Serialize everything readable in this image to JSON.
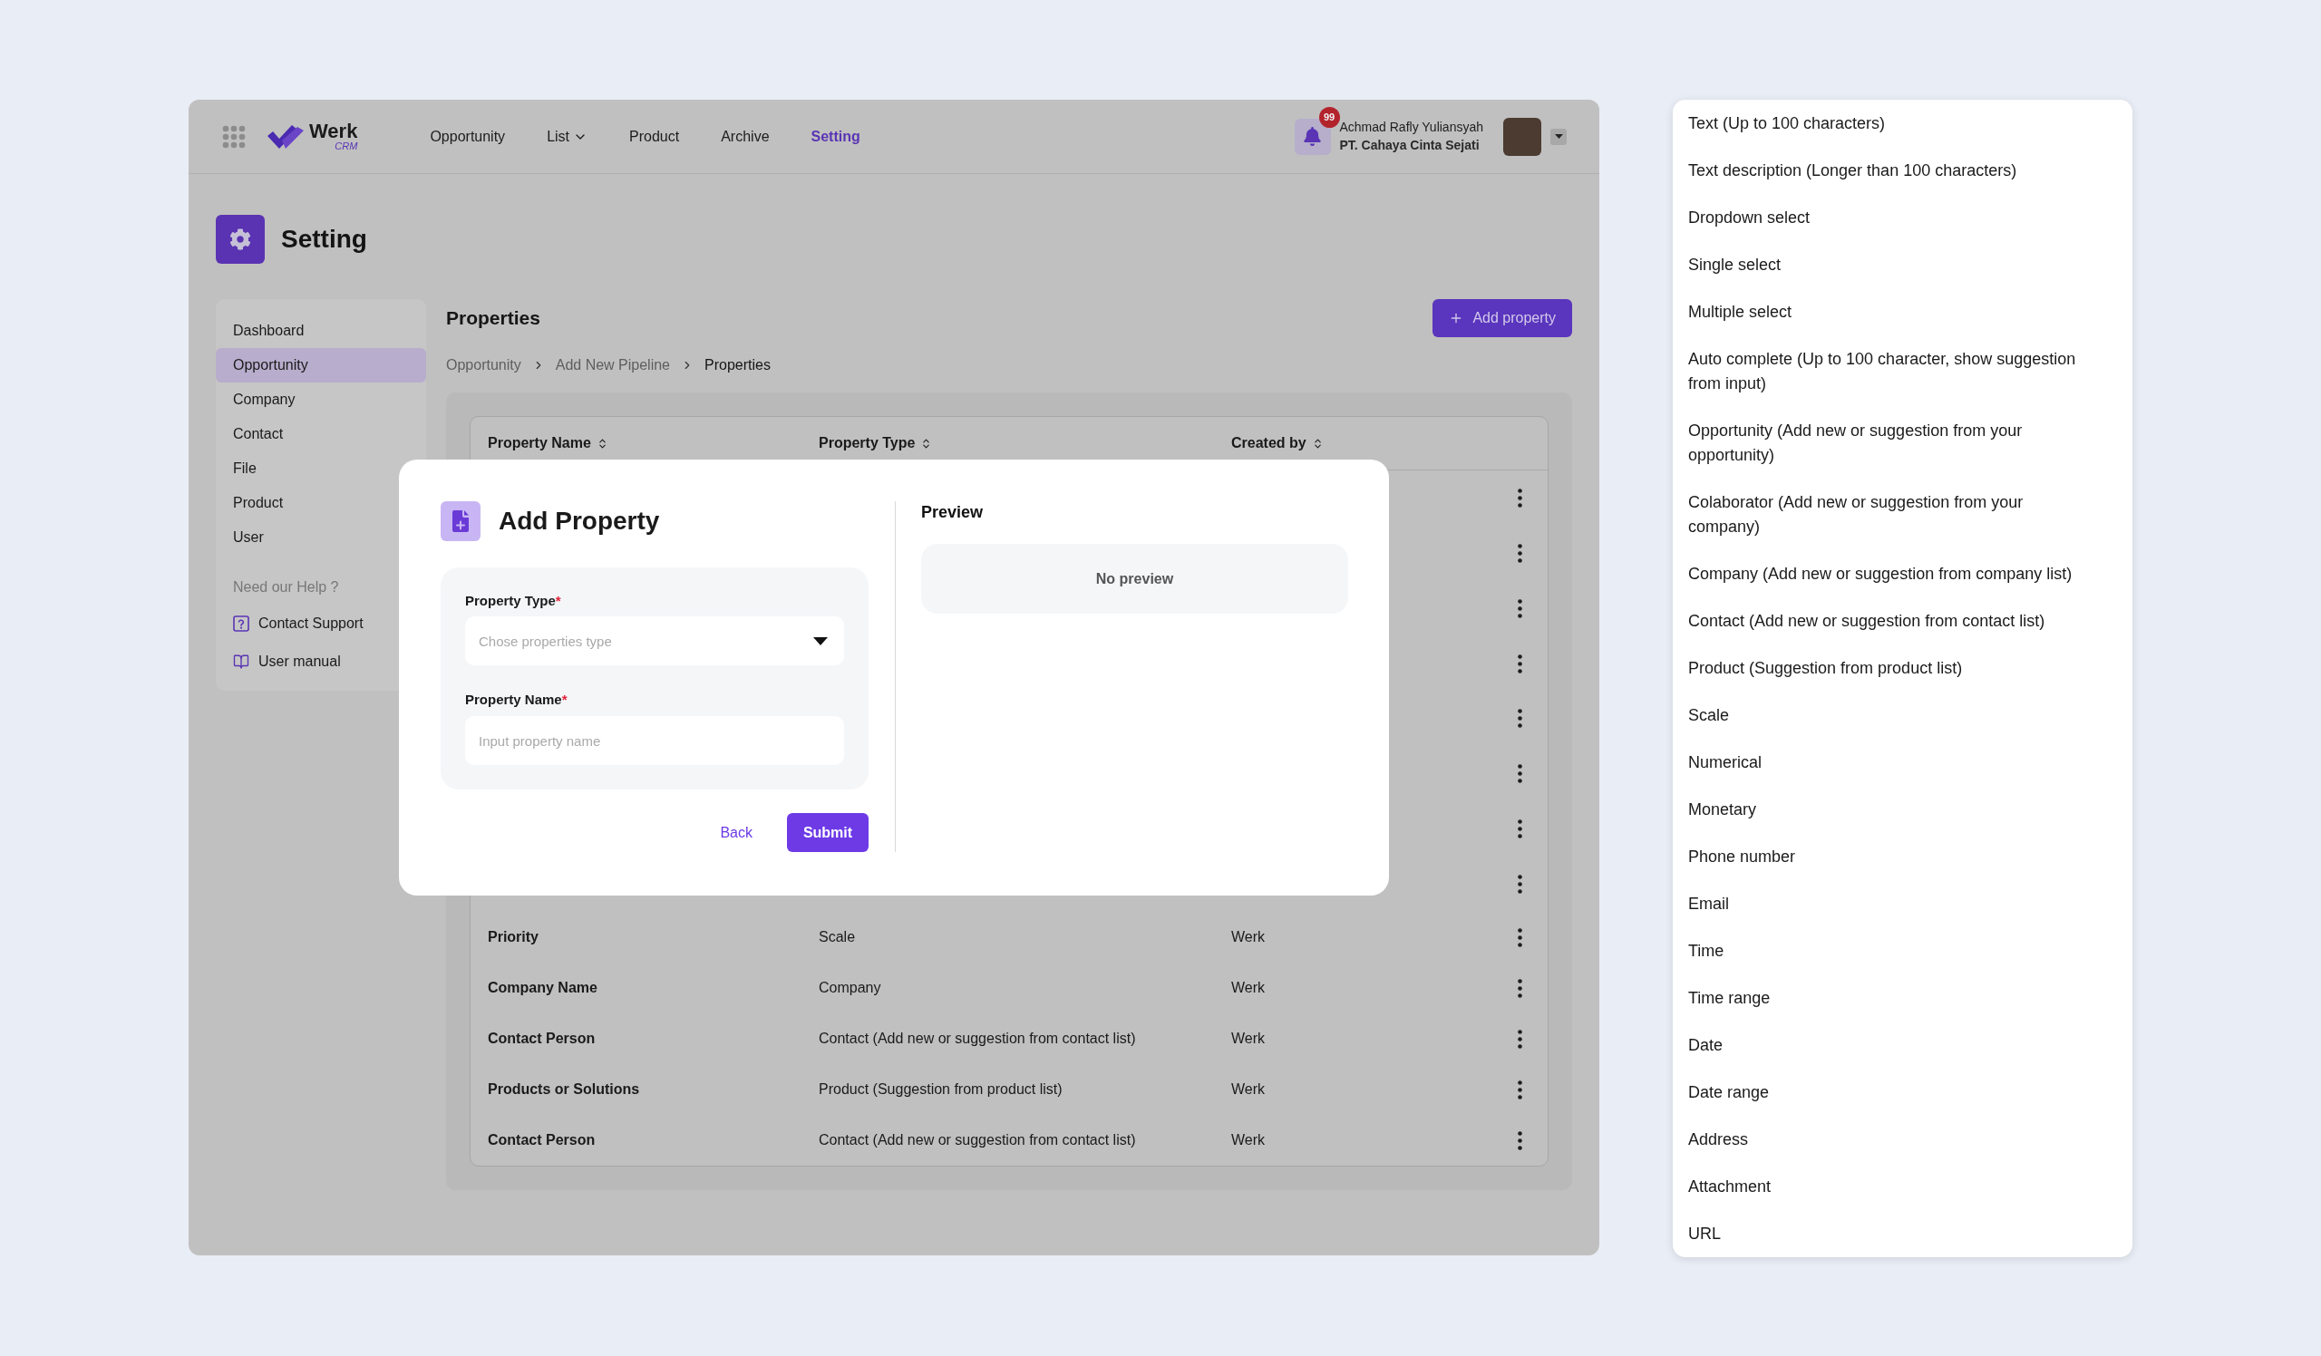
{
  "header": {
    "logo": {
      "name": "Werk",
      "tagline": "CRM"
    },
    "nav": [
      {
        "label": "Opportunity",
        "selected": false,
        "dropdown": false
      },
      {
        "label": "List",
        "selected": false,
        "dropdown": true
      },
      {
        "label": "Product",
        "selected": false,
        "dropdown": false
      },
      {
        "label": "Archive",
        "selected": false,
        "dropdown": false
      },
      {
        "label": "Setting",
        "selected": true,
        "dropdown": false
      }
    ],
    "notifications": "99",
    "user": {
      "name": "Achmad Rafly Yuliansyah",
      "company": "PT. Cahaya Cinta Sejati"
    }
  },
  "page_title": "Setting",
  "sidebar": {
    "items": [
      {
        "label": "Dashboard",
        "selected": false
      },
      {
        "label": "Opportunity",
        "selected": true
      },
      {
        "label": "Company",
        "selected": false
      },
      {
        "label": "Contact",
        "selected": false
      },
      {
        "label": "File",
        "selected": false
      },
      {
        "label": "Product",
        "selected": false
      },
      {
        "label": "User",
        "selected": false
      }
    ],
    "help_title": "Need our Help ?",
    "help_links": [
      {
        "label": "Contact Support",
        "kind": "support"
      },
      {
        "label": "User manual",
        "kind": "manual"
      }
    ]
  },
  "properties": {
    "title": "Properties",
    "add_button": "Add property",
    "breadcrumb": [
      {
        "label": "Opportunity",
        "current": false
      },
      {
        "label": "Add New Pipeline",
        "current": false
      },
      {
        "label": "Properties",
        "current": true
      }
    ],
    "table": {
      "columns": [
        "Property Name",
        "Property Type",
        "Created by"
      ],
      "rows": [
        {
          "kind": "covered"
        },
        {
          "kind": "covered"
        },
        {
          "kind": "covered"
        },
        {
          "kind": "covered"
        },
        {
          "kind": "covered"
        },
        {
          "kind": "covered"
        },
        {
          "kind": "covered"
        },
        {
          "kind": "covered"
        },
        {
          "kind": "entry",
          "name": "Priority",
          "type": "Scale",
          "created_by": "Werk"
        },
        {
          "kind": "entry",
          "name": "Company Name",
          "type": "Company",
          "created_by": "Werk"
        },
        {
          "kind": "entry",
          "name": "Contact Person",
          "type": "Contact (Add new or suggestion from contact list)",
          "created_by": "Werk"
        },
        {
          "kind": "entry",
          "name": "Products or Solutions",
          "type": "Product (Suggestion from product list)",
          "created_by": "Werk"
        },
        {
          "kind": "entry",
          "name": "Contact Person",
          "type": "Contact (Add new or suggestion from contact list)",
          "created_by": "Werk"
        }
      ]
    }
  },
  "dialog": {
    "title": "Add Property",
    "fields": [
      {
        "kind": "select",
        "label": "Property Type",
        "required_mark": "*",
        "placeholder": "Chose properties type"
      },
      {
        "kind": "text",
        "label": "Property Name",
        "required_mark": "*",
        "placeholder": "Input property name"
      }
    ],
    "buttons": [
      {
        "label": "Back",
        "kind": "text"
      },
      {
        "label": "Submit",
        "kind": "primary"
      }
    ],
    "preview": {
      "title": "Preview",
      "empty_text": "No preview"
    }
  },
  "property_type_options": [
    "Text (Up to 100 characters)",
    "Text description (Longer than 100 characters)",
    "Dropdown select",
    "Single select",
    "Multiple select",
    "Auto complete (Up to 100 character, show suggestion from input)",
    "Opportunity (Add new or suggestion from your opportunity)",
    "Colaborator (Add new or suggestion from your company)",
    "Company (Add new or suggestion from company list)",
    "Contact (Add new or suggestion from contact list)",
    "Product (Suggestion from product list)",
    "Scale",
    "Numerical",
    "Monetary",
    "Phone number",
    "Email",
    "Time",
    "Time range",
    "Date",
    "Date range",
    "Address",
    "Attachment",
    "URL"
  ]
}
